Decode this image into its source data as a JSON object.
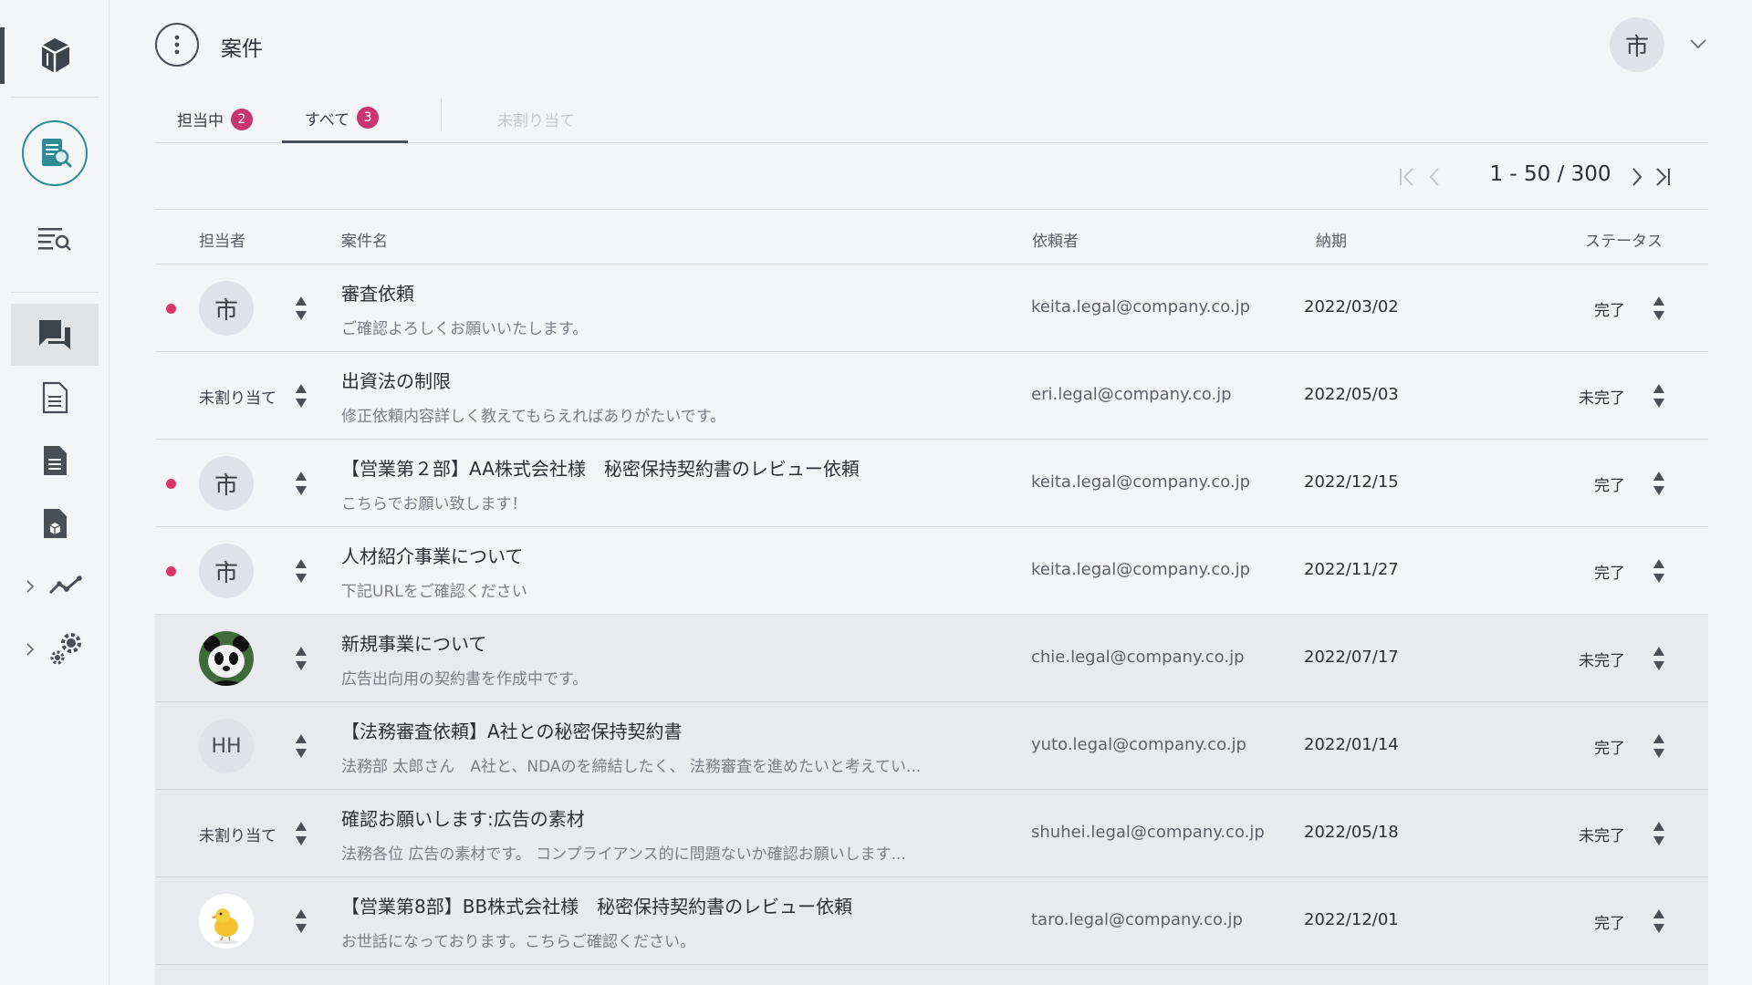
{
  "header": {
    "title": "案件",
    "user_avatar": "市"
  },
  "tabs": [
    {
      "label": "担当中",
      "badge": "2"
    },
    {
      "label": "すべて",
      "badge": "3"
    },
    {
      "label": "未割り当て"
    }
  ],
  "pagination": {
    "range": "1 - 50 / 300"
  },
  "table": {
    "headers": {
      "assignee": "担当者",
      "case_name": "案件名",
      "requester": "依頼者",
      "due": "納期",
      "status": "ステータス"
    },
    "rows": [
      {
        "unread": true,
        "assignee": "市",
        "title": "審査依頼",
        "subtitle": "ご確認よろしくお願いいたします。",
        "requester": "keita.legal@company.co.jp",
        "due": "2022/03/02",
        "status": "完了"
      },
      {
        "unread": false,
        "assignee": "未割り当て",
        "title": "出資法の制限",
        "subtitle": "修正依頼内容詳しく教えてもらえればありがたいです。",
        "requester": "eri.legal@company.co.jp",
        "due": "2022/05/03",
        "status": "未完了"
      },
      {
        "unread": true,
        "assignee": "市",
        "title": "【営業第２部】AA株式会社様　秘密保持契約書のレビュー依頼",
        "subtitle": "こちらでお願い致します！",
        "requester": "keita.legal@company.co.jp",
        "due": "2022/12/15",
        "status": "完了"
      },
      {
        "unread": true,
        "assignee": "市",
        "title": "人材紹介事業について",
        "subtitle": "下記URLをご確認ください",
        "requester": "keita.legal@company.co.jp",
        "due": "2022/11/27",
        "status": "完了"
      },
      {
        "unread": false,
        "assignee_icon": "panda-avatar",
        "title": "新規事業について",
        "subtitle": "広告出向用の契約書を作成中です。",
        "requester": "chie.legal@company.co.jp",
        "due": "2022/07/17",
        "status": "未完了"
      },
      {
        "unread": false,
        "assignee": "HH",
        "title": "【法務審査依頼】A社との秘密保持契約書",
        "subtitle": "法務部 太郎さん　A社と、NDAのを締結したく、 法務審査を進めたいと考えてい...",
        "requester": "yuto.legal@company.co.jp",
        "due": "2022/01/14",
        "status": "完了"
      },
      {
        "unread": false,
        "assignee": "未割り当て",
        "title": "確認お願いします:広告の素材",
        "subtitle": "法務各位 広告の素材です。 コンプライアンス的に問題ないか確認お願いします...",
        "requester": "shuhei.legal@company.co.jp",
        "due": "2022/05/18",
        "status": "未完了"
      },
      {
        "unread": false,
        "assignee_icon": "chick-avatar",
        "title": "【営業第8部】BB株式会社様　秘密保持契約書のレビュー依頼",
        "subtitle": "お世話になっております。こちらご確認ください。",
        "requester": "taro.legal@company.co.jp",
        "due": "2022/12/01",
        "status": "完了"
      }
    ]
  },
  "colors": {
    "accent_badge": "#c9366f",
    "unread_dot": "#d63768",
    "teal": "#2e8b94"
  }
}
